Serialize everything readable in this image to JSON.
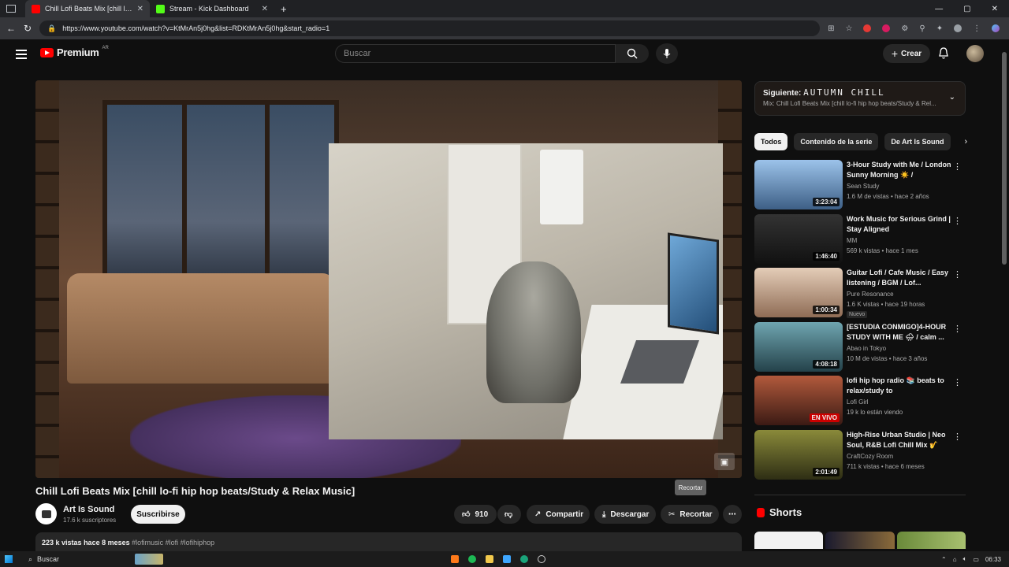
{
  "browser": {
    "tabs": [
      {
        "title": "Chill Lofi Beats Mix [chill lo-fi hip hop beats/Study & Relax Music]",
        "icon": "youtube-favicon",
        "color": "#ff0000"
      },
      {
        "title": "Stream - Kick Dashboard",
        "icon": "kick-favicon",
        "color": "#53fc18"
      }
    ],
    "url": "https://www.youtube.com/watch?v=KtMrAn5j0hg&list=RDKtMrAn5j0hg&start_radio=1"
  },
  "header": {
    "logo": "Premium",
    "logo_sup": "AR",
    "search_placeholder": "Buscar",
    "create_label": "Crear"
  },
  "video": {
    "title": "Chill Lofi Beats Mix [chill lo-fi hip hop beats/Study & Relax Music]",
    "channel": "Art Is Sound",
    "subscribers": "17.6 k suscriptores",
    "subscribe_label": "Suscribirse",
    "likes": "910",
    "share_label": "Compartir",
    "download_label": "Descargar",
    "clip_label": "Recortar",
    "tooltip": "Recortar",
    "views": "223 k vistas",
    "age": "hace 8 meses",
    "tags": "#lofimusic #lofi #lofihiphop"
  },
  "queue": {
    "next_label": "Siguiente:",
    "next_title": "AUTUMN CHILL",
    "mix_title": "Mix: Chill Lofi Beats Mix [chill lo-fi hip hop beats/Study & Rel..."
  },
  "chips": [
    "Todos",
    "Contenido de la serie",
    "De Art Is Sound"
  ],
  "recommendations": [
    {
      "title": "3-Hour Study with Me / London Sunny Morning ☀️ / Pomodoro...",
      "channel": "Sean Study",
      "meta": "1.6 M de vistas • hace 2 años",
      "duration": "3:23:04",
      "thumb_color": "#5d7fa8"
    },
    {
      "title": "Work Music for Serious Grind | Stay Aligned",
      "channel": "MM",
      "meta": "569 k vistas • hace 1 mes",
      "duration": "1:46:40",
      "thumb_color": "#222222"
    },
    {
      "title": "Guitar Lofi / Cafe Music / Easy listening / BGM / Lof...",
      "channel": "Pure Resonance",
      "meta": "1.6 K vistas • hace 19 horas",
      "duration": "1:00:34",
      "badge": "Nuevo",
      "thumb_color": "#c9a78e"
    },
    {
      "title": "[ESTUDIA CONMIGO]4-HOUR STUDY WITH ME 🌧 / calm ...",
      "channel": "Abao in Tokyo",
      "meta": "10 M de vistas • hace 3 años",
      "duration": "4:08:18",
      "thumb_color": "#3f6f7a"
    },
    {
      "title": "lofi hip hop radio 📚 beats to relax/study to",
      "channel": "Lofi Girl",
      "meta": "19 k lo están viendo",
      "live": "EN VIVO",
      "thumb_color": "#7a3a2a"
    },
    {
      "title": "High-Rise Urban Studio | Neo Soul, R&B Lofi Chill Mix 🎷",
      "channel": "CraftCozy Room",
      "meta": "711 k vistas • hace 6 meses",
      "duration": "2:01:49",
      "thumb_color": "#4a4a2a"
    }
  ],
  "shorts": {
    "label": "Shorts"
  },
  "taskbar": {
    "search": "Buscar",
    "time": "06:33"
  }
}
